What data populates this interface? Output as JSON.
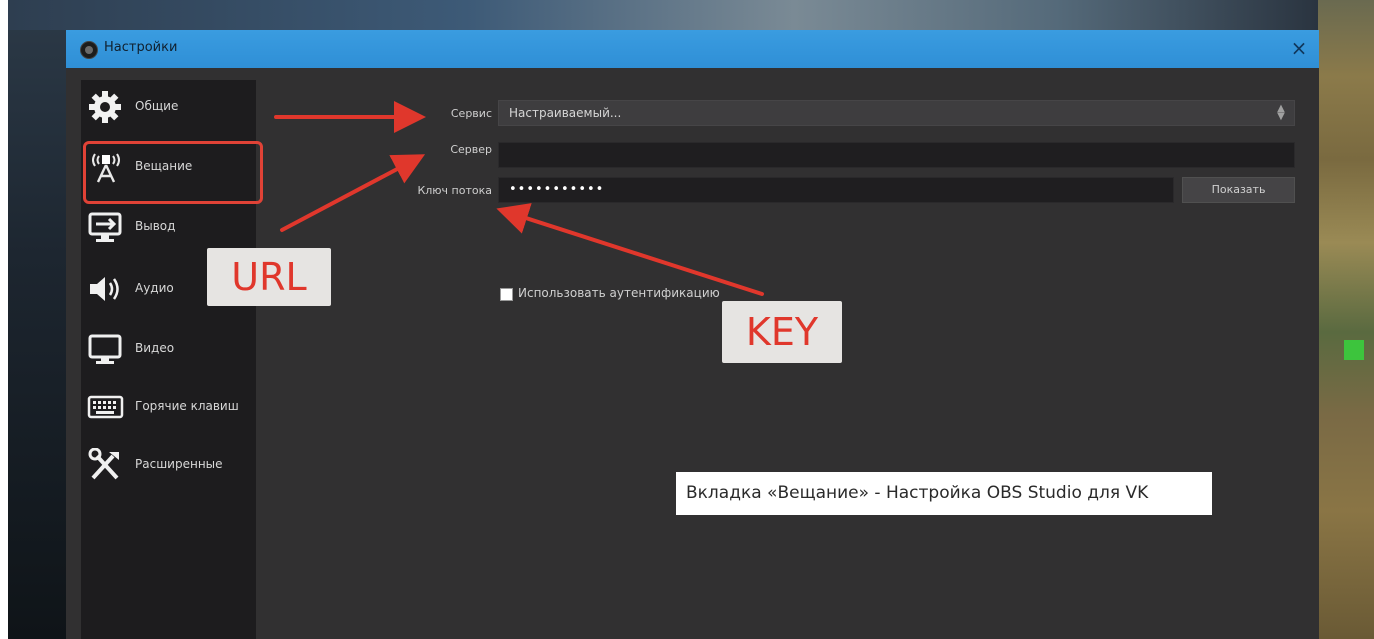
{
  "window": {
    "title": "Настройки",
    "close_glyph": "×"
  },
  "sidebar": {
    "items": [
      {
        "label": "Общие",
        "icon": "gear-icon"
      },
      {
        "label": "Вещание",
        "icon": "broadcast-antenna-icon",
        "selected": true
      },
      {
        "label": "Вывод",
        "icon": "output-monitor-icon"
      },
      {
        "label": "Аудио",
        "icon": "speaker-icon"
      },
      {
        "label": "Видео",
        "icon": "monitor-icon"
      },
      {
        "label": "Горячие клавиш",
        "icon": "keyboard-icon"
      },
      {
        "label": "Расширенные",
        "icon": "tools-icon"
      }
    ]
  },
  "stream": {
    "service_label": "Сервис",
    "service_value": "Настраиваемый...",
    "server_label": "Сервер",
    "server_value": "",
    "key_label": "Ключ потока",
    "key_value": "•••••••••••",
    "show_button": "Показать",
    "auth_checkbox_label": "Использовать аутентификацию",
    "auth_checked": false
  },
  "annotations": {
    "url_callout": "URL",
    "key_callout": "KEY",
    "caption": "Вкладка «Вещание» - Настройка OBS Studio для VK",
    "highlight_color": "#e04236",
    "arrow_color": "#e0372c"
  },
  "colors": {
    "titlebar": "#3a9ce0",
    "window_bg": "#313031",
    "sidebar_bg": "#1d1c1e"
  }
}
